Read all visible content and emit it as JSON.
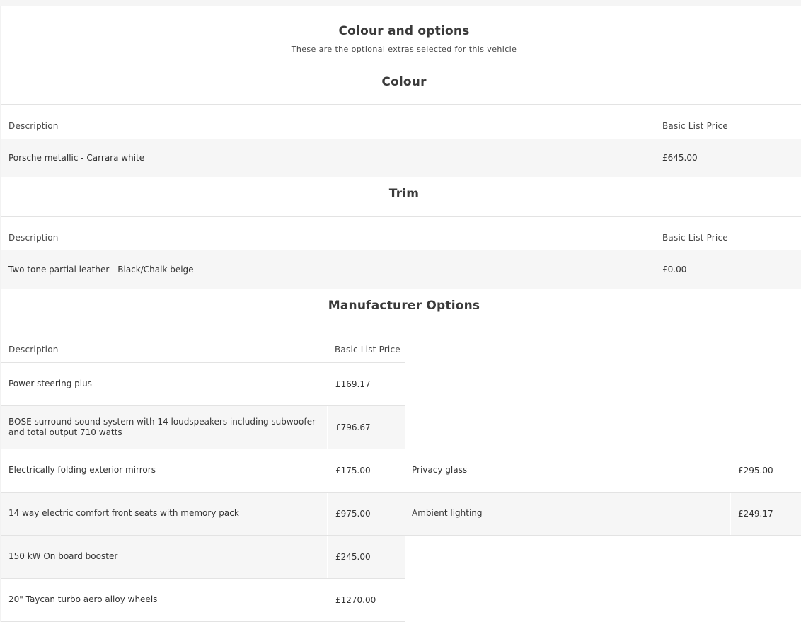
{
  "header": {
    "title": "Colour and options",
    "subtitle": "These are the optional extras selected for this vehicle"
  },
  "colour": {
    "title": "Colour",
    "col_description": "Description",
    "col_price": "Basic List Price",
    "item": {
      "description": "Porsche metallic - Carrara white",
      "price": "£645.00"
    }
  },
  "trim": {
    "title": "Trim",
    "col_description": "Description",
    "col_price": "Basic List Price",
    "item": {
      "description": "Two tone partial leather - Black/Chalk beige",
      "price": "£0.00"
    }
  },
  "manufacturer": {
    "title": "Manufacturer Options",
    "col_description": "Description",
    "col_price": "Basic List Price",
    "left": [
      {
        "description": "Power steering plus",
        "price": "£169.17"
      },
      {
        "description": "BOSE surround sound system with 14 loudspeakers including subwoofer and total output 710 watts",
        "price": "£796.67"
      },
      {
        "description": "Electrically folding exterior mirrors",
        "price": "£175.00"
      },
      {
        "description": "14 way electric comfort front seats with memory pack",
        "price": "£975.00"
      },
      {
        "description": "150 kW On board booster",
        "price": "£245.00"
      },
      {
        "description": "20\" Taycan turbo aero alloy wheels",
        "price": "£1270.00"
      }
    ],
    "right": [
      {
        "description": "Privacy glass",
        "price": "£295.00"
      },
      {
        "description": "Ambient lighting",
        "price": "£249.17"
      }
    ]
  },
  "colors": {
    "row_shade": "#f6f6f6",
    "divider": "#e3e3e3",
    "text": "#333333"
  }
}
